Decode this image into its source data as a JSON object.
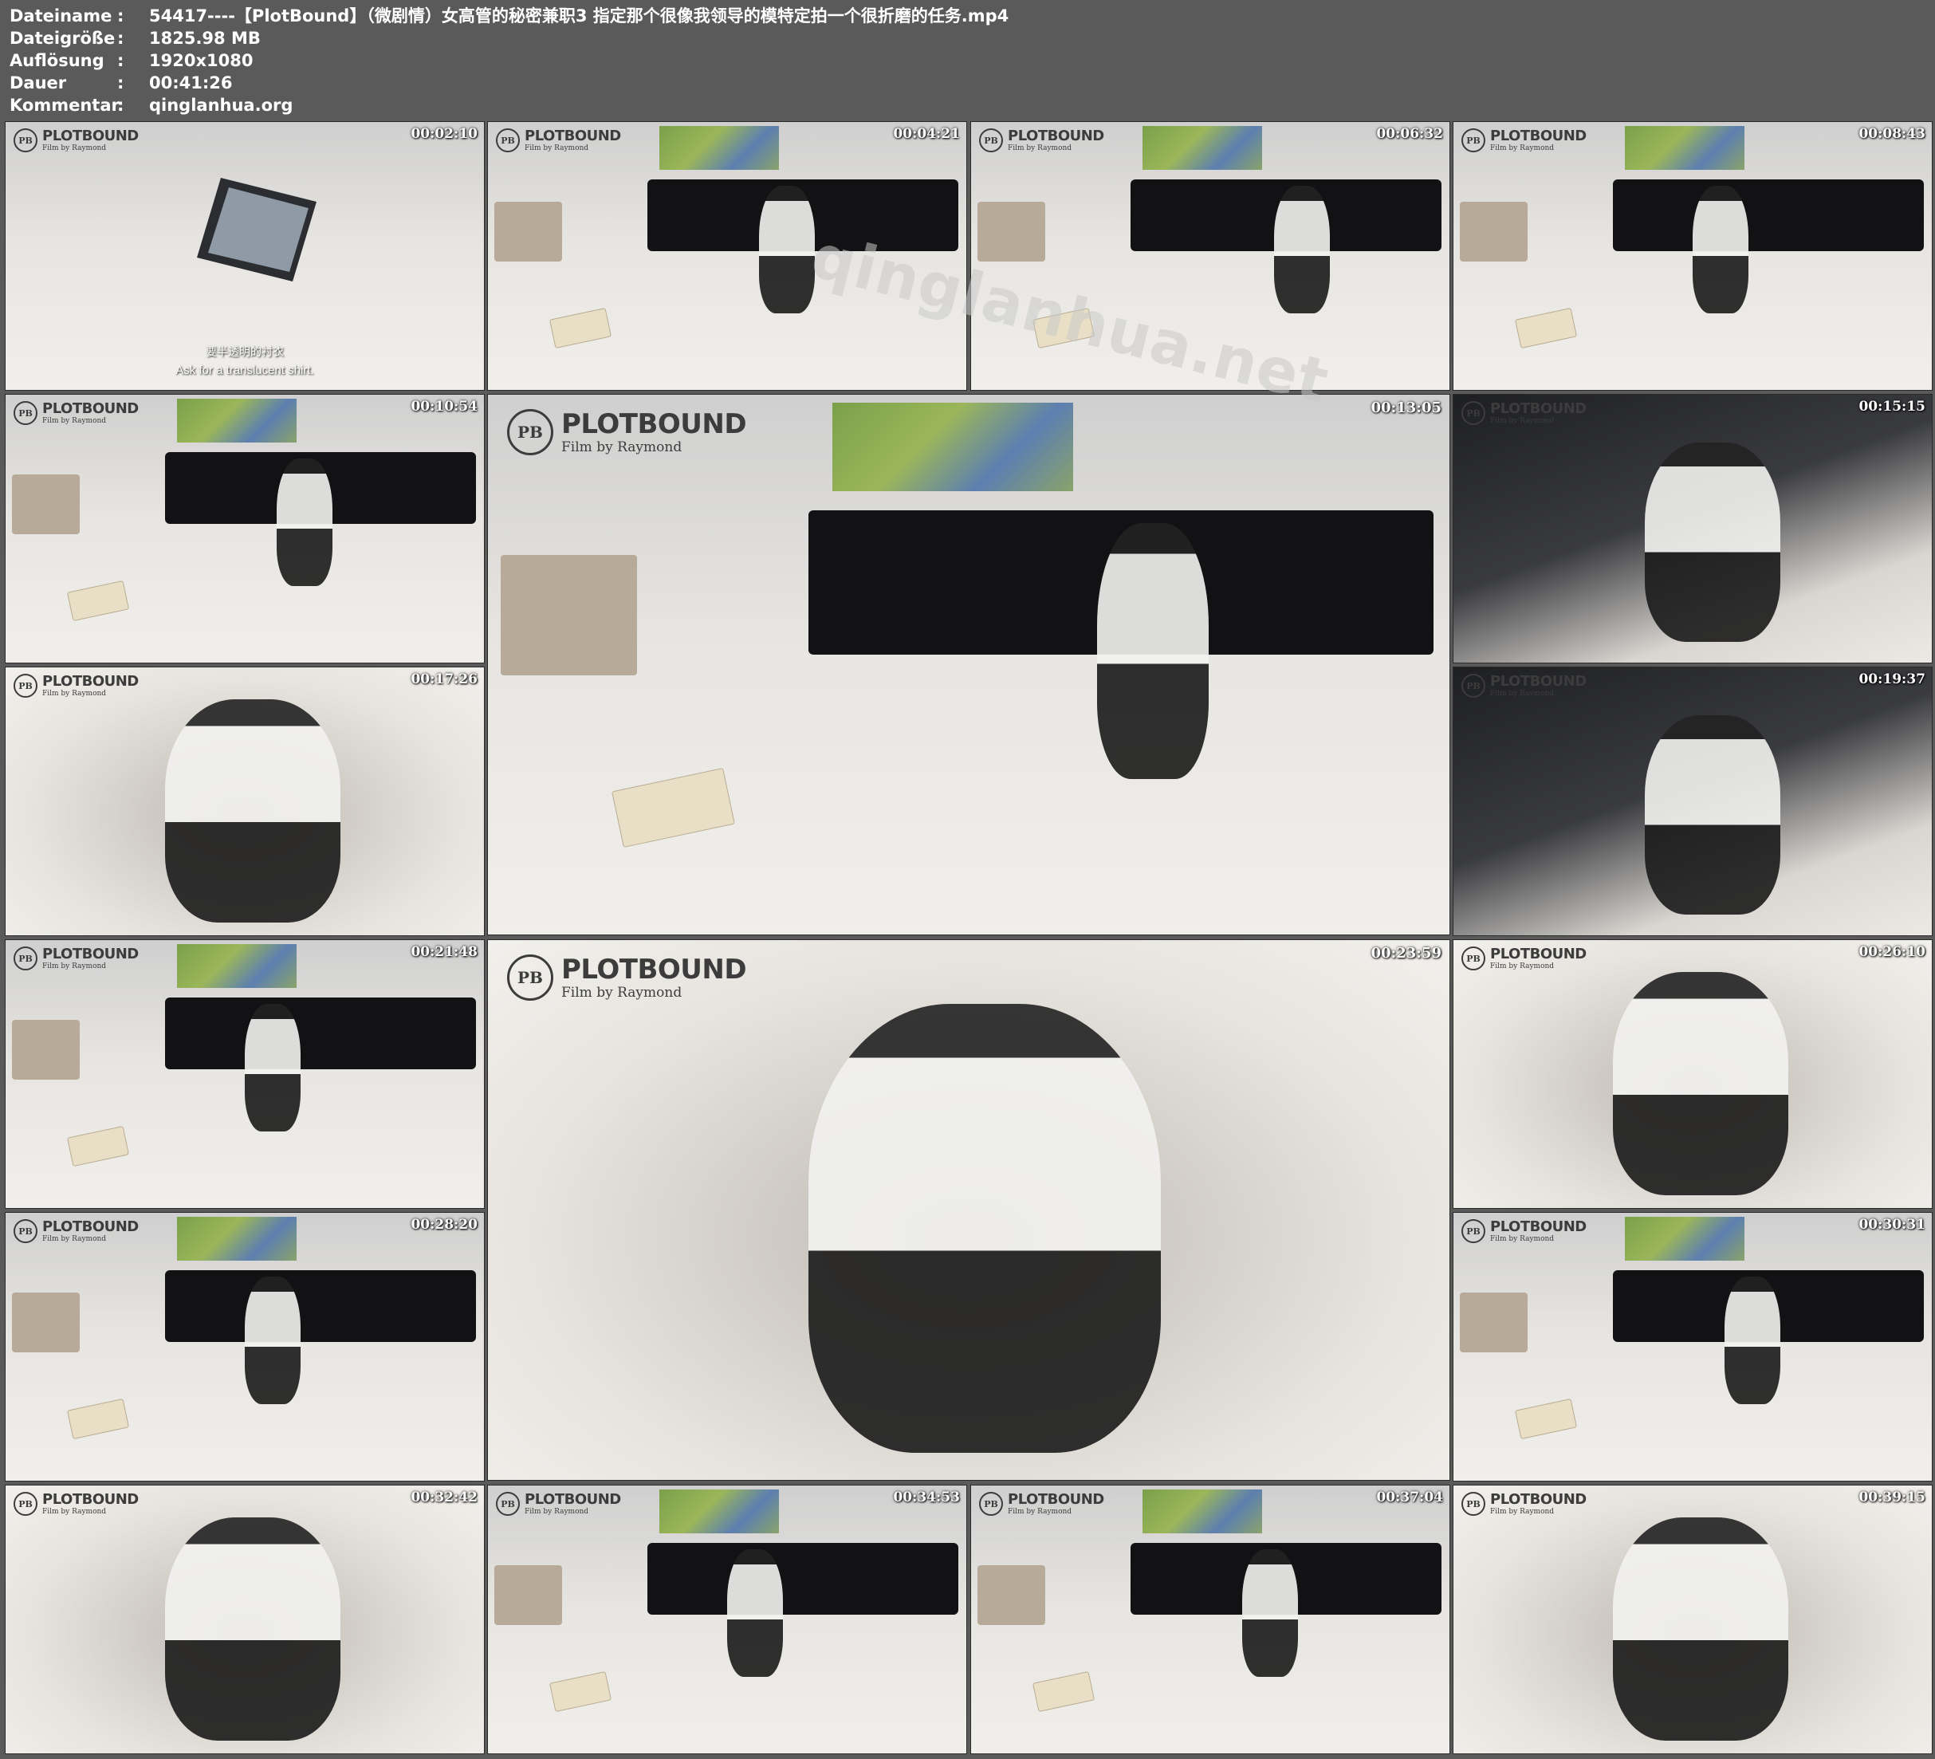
{
  "meta": [
    {
      "key": "Dateiname",
      "value": "54417----【PlotBound】（微剧情）女高管的秘密兼职3 指定那个很像我领导的模特定拍一个很折磨的任务.mp4"
    },
    {
      "key": "Dateigröße",
      "value": "1825.98 MB"
    },
    {
      "key": "Auflösung",
      "value": "1920x1080"
    },
    {
      "key": "Dauer",
      "value": "00:41:26"
    },
    {
      "key": "Kommentar",
      "value": "qinglanhua.org"
    }
  ],
  "meta_separator": ":",
  "logo": {
    "brand": "PLOTBOUND",
    "sub": "Film by Raymond",
    "mark": "PB"
  },
  "watermark": "qinglanhua.net",
  "frames": [
    {
      "timestamp": "00:02:10",
      "subtitle_cn": "要半透明的衬衣",
      "subtitle_en": "Ask for a translucent shirt."
    },
    {
      "timestamp": "00:04:21"
    },
    {
      "timestamp": "00:06:32"
    },
    {
      "timestamp": "00:08:43"
    },
    {
      "timestamp": "00:10:54"
    },
    {
      "timestamp": "00:13:05"
    },
    {
      "timestamp": "00:15:15"
    },
    {
      "timestamp": "00:17:26"
    },
    {
      "timestamp": "00:19:37"
    },
    {
      "timestamp": "00:21:48"
    },
    {
      "timestamp": "00:23:59"
    },
    {
      "timestamp": "00:26:10"
    },
    {
      "timestamp": "00:28:20"
    },
    {
      "timestamp": "00:30:31"
    },
    {
      "timestamp": "00:32:42"
    },
    {
      "timestamp": "00:34:53"
    },
    {
      "timestamp": "00:37:04"
    },
    {
      "timestamp": "00:39:15"
    }
  ]
}
